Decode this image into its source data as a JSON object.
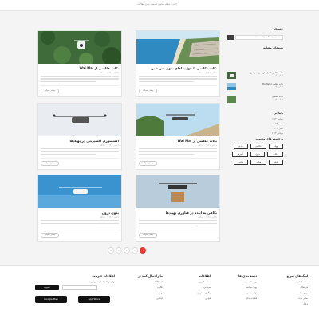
{
  "colors": {
    "accent": "#e53935",
    "footer_bg": "#ffffff",
    "page_bg": "#f4f4f4"
  },
  "breadcrumb": {
    "text": "خانه  »  مجله شامی  »  دسته بندی مقالات"
  },
  "posts": [
    {
      "title": "نکات عکاسی با هواپیماهای بدون سرنشین",
      "meta": "۲۹ آذر ۱۴۰۲ | ۰ دیدگاه",
      "more": "بیشتر بخوانید",
      "image": "beach-coast"
    },
    {
      "title": "نکات عکاسی از Wai Mai",
      "meta": "۲۹ آذر ۱۴۰۲ | ۰ دیدگاه",
      "more": "بیشتر بخوانید",
      "image": "white-drone-over-forest"
    },
    {
      "title": "نکات عکاسی از Wai Mai",
      "meta": "۲۹ آذر ۱۴۰۲ | ۰ دیدگاه",
      "more": "بیشتر بخوانید",
      "image": "drone-cliff-sky"
    },
    {
      "title": "اکسسوری اکسیزیتی در پهپادها",
      "meta": "۲۹ آذر ۱۴۰۲ | ۰ دیدگاه",
      "more": "بیشتر بخوانید",
      "image": "gray-drone-flying"
    },
    {
      "title": "نگاهی به آینده در فناوری پهپادها",
      "meta": "۲۹ آذر ۱۴۰۲ | ۰ دیدگاه",
      "more": "بیشتر بخوانید",
      "image": "cargo-drone"
    },
    {
      "title": "بدون درون",
      "meta": "۲۹ آذر ۱۴۰۲ | ۰ دیدگاه",
      "more": "بیشتر بخوانید",
      "image": "white-drone-blue-sky"
    }
  ],
  "pagination": {
    "pages": [
      "۱",
      "۲",
      "۳",
      "۴"
    ],
    "active": 0,
    "next": "›"
  },
  "sidebar": {
    "search_title": "جستجو",
    "search_placeholder": "جستجو در مطالب وبلاگ...",
    "recent_title": "پستهای مشابه",
    "recent": [
      {
        "title": "نکات عکاسی با هواپیمای بدون سرنشین",
        "date": "۲۹ آذر ۱۴۰۲"
      },
      {
        "title": "نکات عکاسی از Wai Mai",
        "date": "۲۹ آذر ۱۴۰۲"
      },
      {
        "title": "نکات عکاسی",
        "date": "۲۹ آذر ۱۴۰۲"
      },
      {
        "title": "نکات عکاسی از Wai Mai",
        "date": "۲۹ آذر ۱۴۰۲"
      }
    ],
    "archive_title": "بایگانی",
    "archive": [
      "دسامبر ۲۰۲۳",
      "نوامبر ۲۰۲۳",
      "اکتبر ۲۰۲۳",
      "سپتامبر ۲۰۲۳"
    ],
    "tags_title": "برچسب های محبوب",
    "tags": [
      "پهپاد",
      "عکاسی",
      "ویدیو",
      "نکات",
      "درون",
      "آموزش",
      "فیلم",
      "هوایی",
      "شامی"
    ]
  },
  "footer": {
    "col1": {
      "title": "لینک های سریع",
      "links": [
        "صفحه اصلی",
        "فروشگاه",
        "درباره ما",
        "تماس با ما",
        "وبلاگ"
      ]
    },
    "col2": {
      "title": "دسته بندی ها",
      "links": [
        "پهپاد عکاسی",
        "پهپاد مسابقه",
        "لوازم جانبی",
        "قطعات یدکی"
      ]
    },
    "col3": {
      "title": "اطلاعات",
      "links": [
        "حساب کاربری",
        "سبد خرید",
        "پیگیری سفارش",
        "قوانین"
      ]
    },
    "col4": {
      "title": "ما را دنبال کنید در",
      "links": [
        "اینستاگرام",
        "تلگرام",
        "یوتیوب",
        "لینکدین"
      ]
    },
    "col5": {
      "title": "اطلاعات خبرنامه",
      "desc": "برای دریافت اخبار عضو شوید",
      "subscribe": "عضویت",
      "google_play": "Google Play",
      "app_store": "App Store"
    }
  }
}
